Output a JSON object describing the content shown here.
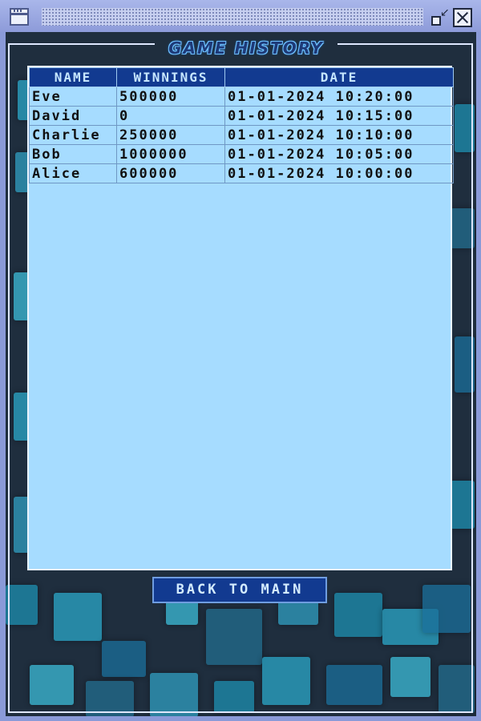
{
  "window": {
    "controls": {
      "app_icon": "window-icon",
      "restore_icon": "restore-icon",
      "close_icon": "close-icon"
    }
  },
  "screen": {
    "title": "GAME HISTORY",
    "back_button": "BACK TO MAIN"
  },
  "table": {
    "headers": [
      "NAME",
      "WINNINGS",
      "DATE"
    ],
    "rows": [
      {
        "name": "Eve",
        "winnings": "500000",
        "date": "01-01-2024 10:20:00"
      },
      {
        "name": "David",
        "winnings": "0",
        "date": "01-01-2024 10:15:00"
      },
      {
        "name": "Charlie",
        "winnings": "250000",
        "date": "01-01-2024 10:10:00"
      },
      {
        "name": "Bob",
        "winnings": "1000000",
        "date": "01-01-2024 10:05:00"
      },
      {
        "name": "Alice",
        "winnings": "600000",
        "date": "01-01-2024 10:00:00"
      }
    ]
  },
  "colors": {
    "header_bg": "#123a90",
    "panel_bg": "#a6dcff",
    "app_bg": "#1f2e3e",
    "chrome": "#8a9ad8"
  }
}
